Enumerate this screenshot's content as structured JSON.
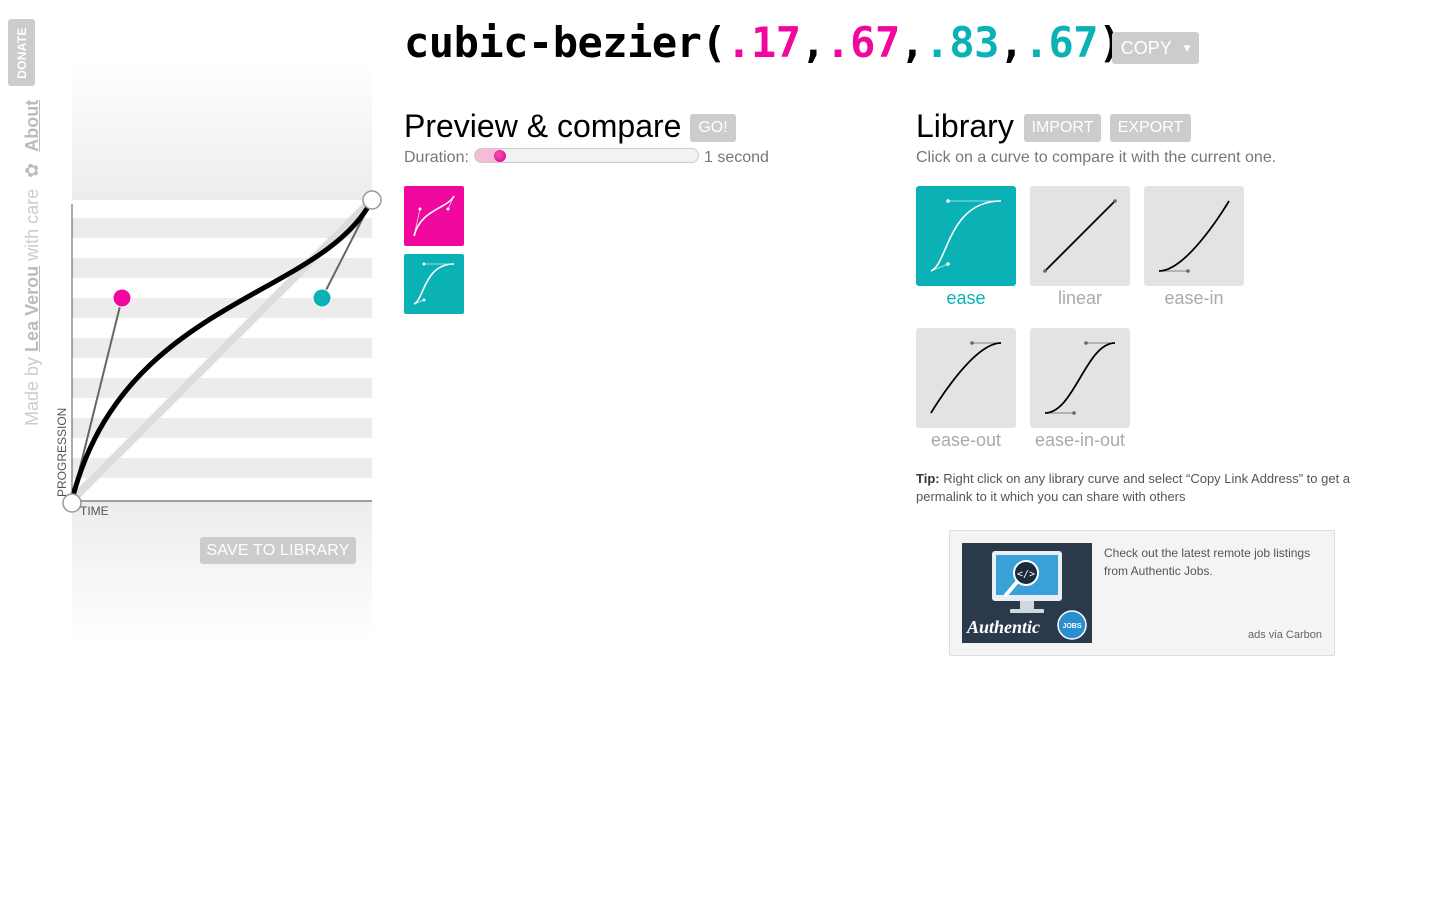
{
  "sidebar": {
    "donate_label": "DONATE",
    "made_by_prefix": "Made by",
    "author": "Lea Verou",
    "with_care": "with care",
    "about": "About"
  },
  "editor": {
    "axis_y": "PROGRESSION",
    "axis_x": "TIME",
    "save_label": "SAVE TO LIBRARY",
    "control_points": {
      "p1": [
        0.17,
        0.67
      ],
      "p2": [
        0.83,
        0.67
      ]
    },
    "comparison_curve": "linear"
  },
  "title": {
    "prefix": "cubic-bezier(",
    "v1": ".17",
    "sep1": ",",
    "v2": ".67",
    "sep2": ",",
    "v3": ".83",
    "sep3": ",",
    "v4": ".67",
    "suffix": ")",
    "copy_label": "COPY",
    "copy_caret": "▾"
  },
  "preview": {
    "heading": "Preview & compare",
    "go_label": "GO!",
    "duration_label": "Duration:",
    "duration_value": "1 second",
    "duration_fraction": 0.11
  },
  "library": {
    "heading": "Library",
    "import_label": "IMPORT",
    "export_label": "EXPORT",
    "description": "Click on a curve to compare it with the current one.",
    "items": [
      {
        "label": "ease",
        "active": true
      },
      {
        "label": "linear",
        "active": false
      },
      {
        "label": "ease-in",
        "active": false
      },
      {
        "label": "ease-out",
        "active": false
      },
      {
        "label": "ease-in-out",
        "active": false
      }
    ],
    "tip_label": "Tip:",
    "tip_text": "Right click on any library curve and select “Copy Link Address” to get a permalink to it which you can share with others"
  },
  "ad": {
    "text": "Check out the latest remote job listings from Authentic Jobs.",
    "logo_text": "Authentic",
    "badge": "JOBS",
    "via": "ads via Carbon"
  },
  "colors": {
    "pink": "#f0079e",
    "teal": "#0ab1b5",
    "button_gray": "#cccccc"
  }
}
